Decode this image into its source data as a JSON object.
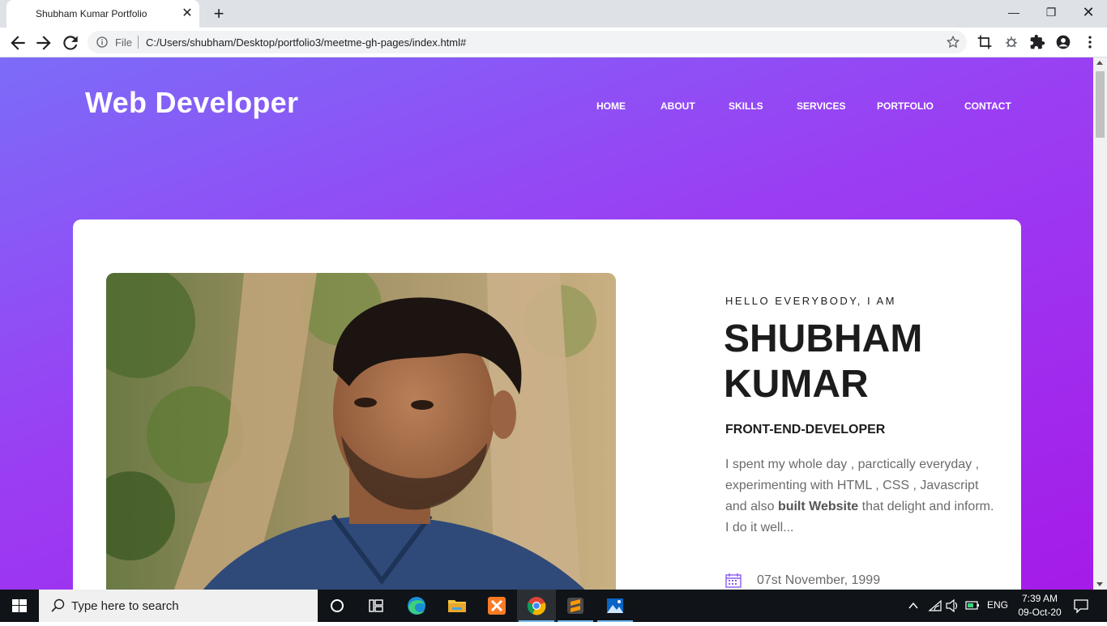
{
  "browser": {
    "tab_title": "Shubham Kumar Portfolio",
    "tab_close": "✕",
    "new_tab": "+",
    "window_min": "—",
    "window_max": "❐",
    "window_close": "✕",
    "url_scheme_label": "File",
    "url": "C:/Users/shubham/Desktop/portfolio3/meetme-gh-pages/index.html#"
  },
  "site": {
    "brand": "Web Developer",
    "nav": [
      "HOME",
      "ABOUT",
      "SKILLS",
      "SERVICES",
      "PORTFOLIO",
      "CONTACT"
    ]
  },
  "hero": {
    "greeting": "HELLO EVERYBODY, I AM",
    "name_line1": "SHUBHAM",
    "name_line2": "KUMAR",
    "role": "FRONT-END-DEVELOPER",
    "bio_before": "I spent my whole day , parctically everyday , experimenting with HTML , CSS , Javascript and also ",
    "bio_bold": "built Website",
    "bio_after": " that delight and inform. I do it well...",
    "dob": "07st November, 1999"
  },
  "taskbar": {
    "search_placeholder": "Type here to search",
    "language": "ENG",
    "time": "7:39 AM",
    "date": "09-Oct-20"
  },
  "colors": {
    "gradient_start": "#7c6cf8",
    "gradient_mid": "#9a3ef3",
    "gradient_end": "#a51be8",
    "text_dark": "#1c1c1c",
    "text_muted": "#6b6b6b",
    "accent_icon": "#8a5cf6"
  },
  "icons": [
    "back-arrow-icon",
    "forward-arrow-icon",
    "reload-icon",
    "info-icon",
    "star-icon",
    "screenshot-icon",
    "extension-bug-icon",
    "puzzle-icon",
    "account-icon",
    "more-vert-icon",
    "calendar-icon",
    "windows-start-icon",
    "search-icon",
    "cortana-icon",
    "task-view-icon",
    "edge-icon",
    "file-explorer-icon",
    "xampp-icon",
    "chrome-icon",
    "sublime-icon",
    "photos-icon",
    "chevron-up-icon",
    "wifi-icon",
    "volume-icon",
    "battery-icon",
    "notification-icon"
  ]
}
